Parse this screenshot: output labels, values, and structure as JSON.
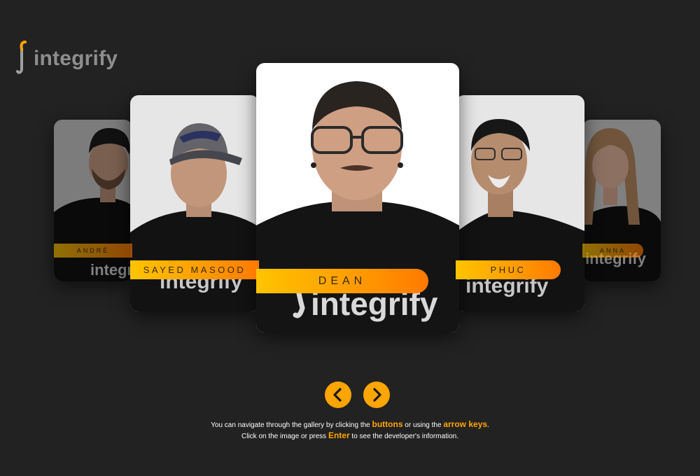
{
  "brand": {
    "name": "integrify",
    "accent_color": "#ffa500",
    "background_color": "#222222"
  },
  "gallery": {
    "cards": [
      {
        "name": "André",
        "position": "far-left",
        "shirt_text": "integrify"
      },
      {
        "name": "Sayed Masood",
        "position": "left",
        "shirt_text": "integrify"
      },
      {
        "name": "Dean",
        "position": "center",
        "active": true,
        "shirt_text": "integrify"
      },
      {
        "name": "Phuc",
        "position": "right",
        "shirt_text": "integrify"
      },
      {
        "name": "Anna",
        "position": "far-right",
        "shirt_text": "integrify"
      }
    ]
  },
  "navigation": {
    "prev_icon": "chevron-left-icon",
    "next_icon": "chevron-right-icon"
  },
  "help": {
    "line1_part1": "You can navigate through the gallery by clicking the",
    "line1_highlight1": "buttons",
    "line1_part2": "or using the",
    "line1_highlight2": "arrow keys",
    "line1_end": ".",
    "line2_part1": "Click on the image or press",
    "line2_highlight": "Enter",
    "line2_part2": "to see the developer's information."
  }
}
